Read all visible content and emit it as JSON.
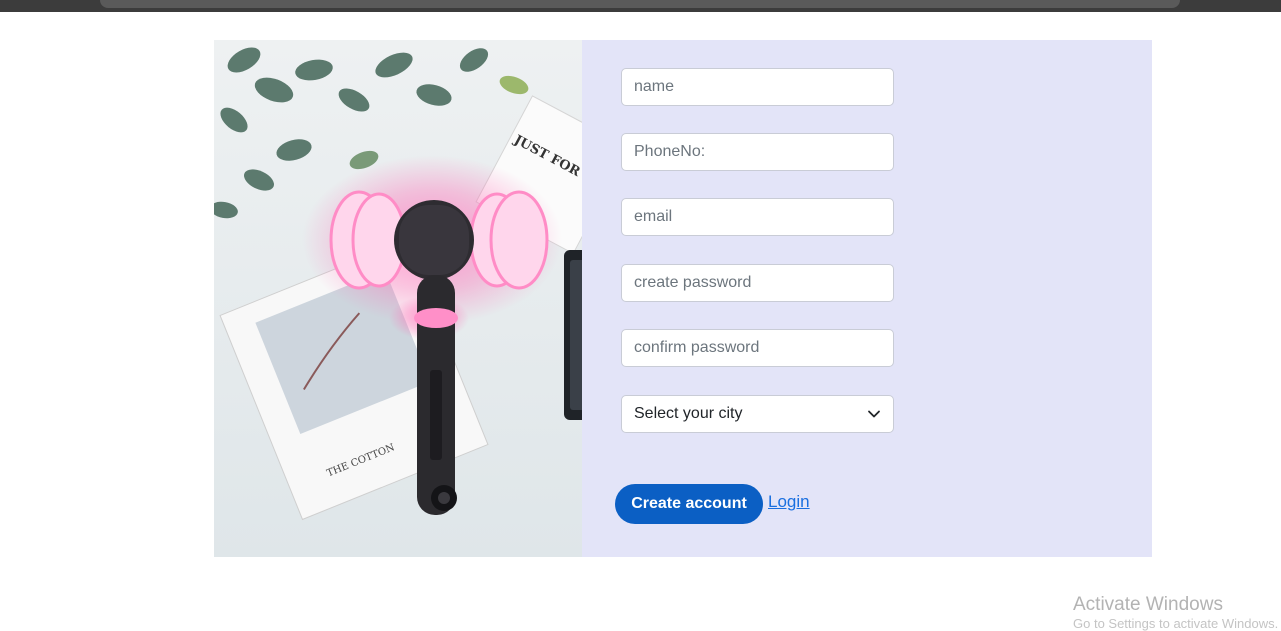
{
  "form": {
    "name_placeholder": "name",
    "phone_placeholder": "PhoneNo:",
    "email_placeholder": "email",
    "create_password_placeholder": "create password",
    "confirm_password_placeholder": "confirm password",
    "city_select_value": "Select your city",
    "create_account_label": "Create account",
    "login_label": "Login"
  },
  "photo": {
    "card_text": "JUST FOR YOU",
    "book_text": "THE COTTON"
  },
  "os": {
    "watermark_title": "Activate Windows",
    "watermark_sub": "Go to Settings to activate Windows."
  },
  "colors": {
    "card_background": "#e3e4f8",
    "primary_button": "#0b5fc4",
    "link": "#1a6fe0"
  }
}
